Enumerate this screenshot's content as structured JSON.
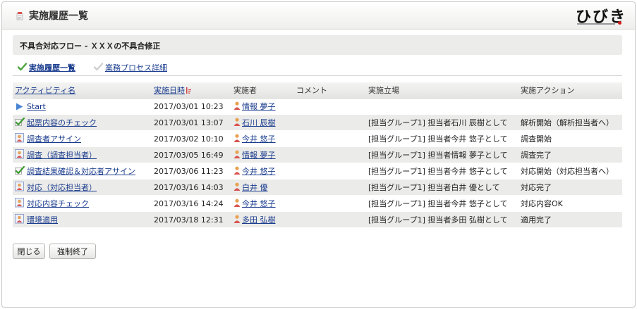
{
  "window": {
    "title": "実施履歴一覧",
    "icon": "document-icon"
  },
  "logo": {
    "text": "ひびき"
  },
  "header": {
    "title": "不具合対応フロー - ＸＸＸの不具合修正"
  },
  "subtabs": [
    {
      "label": "実施履歴一覧",
      "icon": "check-icon",
      "active": true
    },
    {
      "label": "業務プロセス詳細",
      "icon": "check-icon",
      "active": false
    }
  ],
  "table": {
    "headers": {
      "activity": "アクティビティ名",
      "datetime": "実施日時",
      "performer": "実施者",
      "comment": "コメント",
      "position": "実施立場",
      "action": "実施アクション"
    },
    "rows": [
      {
        "icon": "start-arrow-icon",
        "activity": "Start",
        "datetime": "2017/03/01 10:23",
        "performer": "情報 夢子",
        "comment": "",
        "position": "",
        "action": ""
      },
      {
        "icon": "approve-check-icon",
        "activity": "起票内容のチェック",
        "datetime": "2017/03/01 13:07",
        "performer": "石川 辰樹",
        "comment": "",
        "position": "[担当グループ1] 担当者石川 辰樹として",
        "action": "解析開始（解析担当者へ）"
      },
      {
        "icon": "user-task-icon",
        "activity": "調査者アサイン",
        "datetime": "2017/03/02 10:10",
        "performer": "今井 悠子",
        "comment": "",
        "position": "[担当グループ1] 担当者今井 悠子として",
        "action": "調査開始"
      },
      {
        "icon": "user-task-icon",
        "activity": "調査（調査担当者）",
        "datetime": "2017/03/05 16:49",
        "performer": "情報 夢子",
        "comment": "",
        "position": "[担当グループ1] 担当者情報 夢子として",
        "action": "調査完了"
      },
      {
        "icon": "approve-check-icon",
        "activity": "調査結果確認＆対応者アサイン",
        "datetime": "2017/03/06 11:23",
        "performer": "今井 悠子",
        "comment": "",
        "position": "[担当グループ1] 担当者今井 悠子として",
        "action": "対応開始（対応担当者へ）"
      },
      {
        "icon": "user-task-icon",
        "activity": "対応（対応担当者）",
        "datetime": "2017/03/16 14:03",
        "performer": "白井 優",
        "comment": "",
        "position": "[担当グループ1] 担当者白井 優として",
        "action": "対応完了"
      },
      {
        "icon": "user-task-icon",
        "activity": "対応内容チェック",
        "datetime": "2017/03/16 14:24",
        "performer": "今井 悠子",
        "comment": "",
        "position": "[担当グループ1] 担当者今井 悠子として",
        "action": "対応内容OK"
      },
      {
        "icon": "user-task-icon",
        "activity": "環境適用",
        "datetime": "2017/03/18 12:31",
        "performer": "多田 弘樹",
        "comment": "",
        "position": "[担当グループ1] 担当者多田 弘樹として",
        "action": "適用完了"
      }
    ]
  },
  "buttons": {
    "close": "閉じる",
    "force_end": "強制終了"
  },
  "colors": {
    "link": "#1a3c8e",
    "row_alt": "#ebebe9",
    "header_bg": "#ececea",
    "logo_dot": "#d21e1e"
  }
}
